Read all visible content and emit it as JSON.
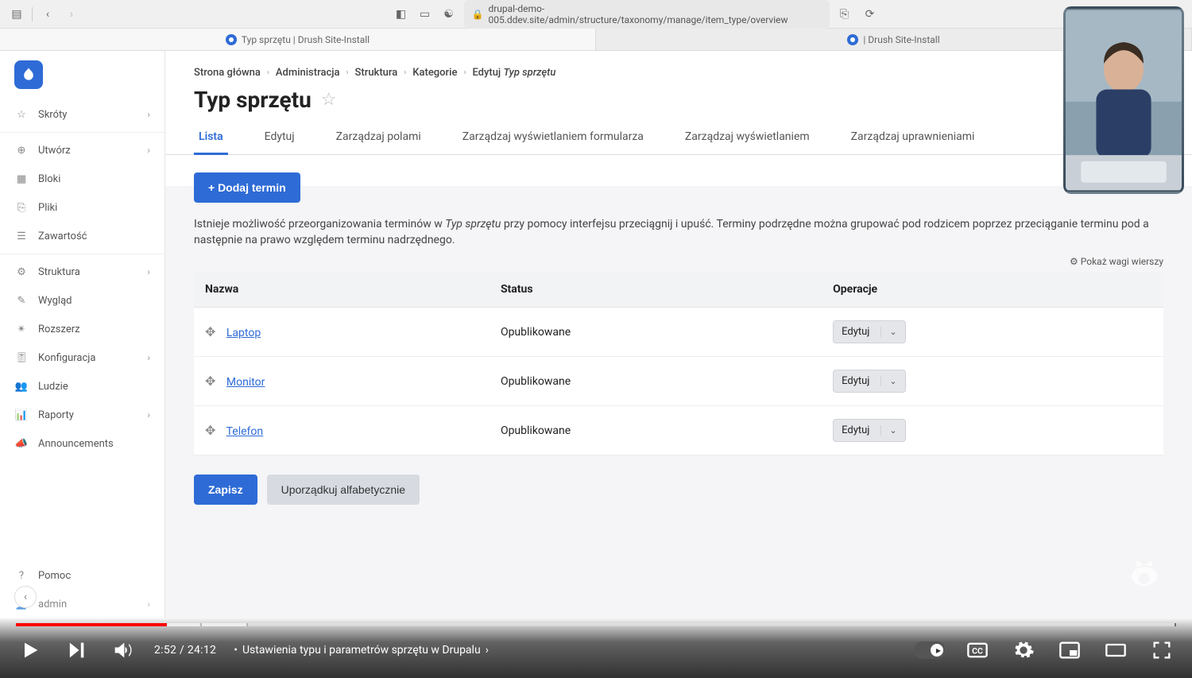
{
  "browser": {
    "url": "drupal-demo-005.ddev.site/admin/structure/taxonomy/manage/item_type/overview",
    "tabs": [
      {
        "label": "Typ sprzętu | Drush Site-Install",
        "active": true
      },
      {
        "label": "| Drush Site-Install",
        "active": false
      }
    ]
  },
  "sidebar": {
    "items": [
      {
        "icon": "star",
        "label": "Skróty",
        "chevron": true
      },
      {
        "icon": "plus-circle",
        "label": "Utwórz",
        "chevron": true
      },
      {
        "icon": "blocks",
        "label": "Bloki",
        "chevron": false
      },
      {
        "icon": "file",
        "label": "Pliki",
        "chevron": false
      },
      {
        "icon": "doc",
        "label": "Zawartość",
        "chevron": false
      },
      {
        "icon": "structure",
        "label": "Struktura",
        "chevron": true
      },
      {
        "icon": "brush",
        "label": "Wygląd",
        "chevron": false
      },
      {
        "icon": "puzzle",
        "label": "Rozszerz",
        "chevron": false
      },
      {
        "icon": "sliders",
        "label": "Konfiguracja",
        "chevron": true
      },
      {
        "icon": "people",
        "label": "Ludzie",
        "chevron": false
      },
      {
        "icon": "chart",
        "label": "Raporty",
        "chevron": true
      },
      {
        "icon": "megaphone",
        "label": "Announcements",
        "chevron": false
      }
    ],
    "bottom": [
      {
        "icon": "help",
        "label": "Pomoc",
        "chevron": false
      },
      {
        "icon": "user",
        "label": "admin",
        "chevron": true
      }
    ]
  },
  "breadcrumb": [
    "Strona główna",
    "Administracja",
    "Struktura",
    "Kategorie"
  ],
  "breadcrumb_last_prefix": "Edytuj",
  "breadcrumb_last_em": "Typ sprzętu",
  "page_title": "Typ sprzętu",
  "tabs": [
    "Lista",
    "Edytuj",
    "Zarządzaj polami",
    "Zarządzaj wyświetlaniem formularza",
    "Zarządzaj wyświetlaniem",
    "Zarządzaj uprawnieniami"
  ],
  "active_tab": "Lista",
  "add_button": "+ Dodaj termin",
  "helptext_pre": "Istnieje możliwość przeorganizowania terminów w ",
  "helptext_em": "Typ sprzętu",
  "helptext_post": " przy pomocy interfejsu przeciągnij i upuść. Terminy podrzędne można grupować pod rodzicem poprzez przeciąganie terminu pod a następnie na prawo względem terminu nadrzędnego.",
  "weights_toggle": "Pokaż wagi wierszy",
  "table": {
    "headers": [
      "Nazwa",
      "Status",
      "Operacje"
    ],
    "rows": [
      {
        "name": "Laptop",
        "status": "Opublikowane",
        "op": "Edytuj"
      },
      {
        "name": "Monitor",
        "status": "Opublikowane",
        "op": "Edytuj"
      },
      {
        "name": "Telefon",
        "status": "Opublikowane",
        "op": "Edytuj"
      }
    ]
  },
  "actions": {
    "save": "Zapisz",
    "sort": "Uporządkuj alfabetycznie"
  },
  "video": {
    "current": "2:52",
    "total": "24:12",
    "chapter": "Ustawienia typu i parametrów sprzętu w Drupalu"
  }
}
